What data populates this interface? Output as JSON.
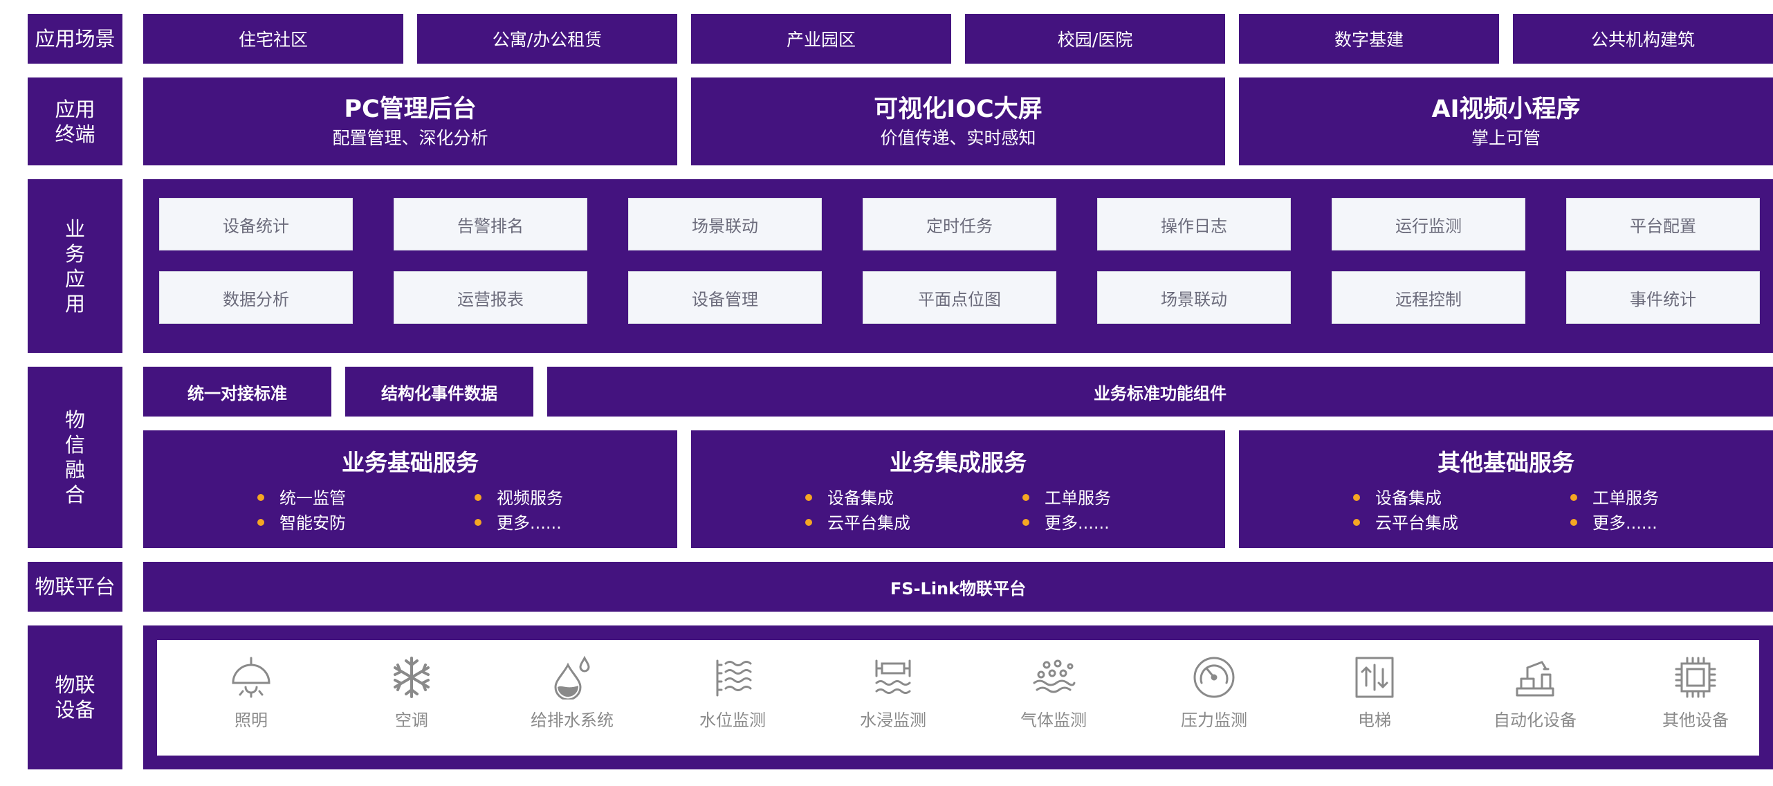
{
  "rows": {
    "scenarios": {
      "label": "应用场景",
      "items": [
        "住宅社区",
        "公寓/办公租赁",
        "产业园区",
        "校园/医院",
        "数字基建",
        "公共机构建筑"
      ]
    },
    "terminals": {
      "label_lines": [
        "应用",
        "终端"
      ],
      "items": [
        {
          "title": "PC管理后台",
          "subtitle": "配置管理、深化分析"
        },
        {
          "title": "可视化IOC大屏",
          "subtitle": "价值传递、实时感知"
        },
        {
          "title": "AI视频小程序",
          "subtitle": "掌上可管"
        }
      ]
    },
    "business": {
      "label_lines": [
        "业",
        "务",
        "应",
        "用"
      ],
      "row1": [
        "设备统计",
        "告警排名",
        "场景联动",
        "定时任务",
        "操作日志",
        "运行监测",
        "平台配置"
      ],
      "row2": [
        "数据分析",
        "运营报表",
        "设备管理",
        "平面点位图",
        "场景联动",
        "远程控制",
        "事件统计"
      ]
    },
    "fusion": {
      "label_lines": [
        "物",
        "信",
        "融",
        "合"
      ],
      "top": [
        "统一对接标准",
        "结构化事件数据",
        "业务标准功能组件"
      ],
      "services": [
        {
          "title": "业务基础服务",
          "items": [
            "统一监管",
            "视频服务",
            "智能安防",
            "更多......"
          ]
        },
        {
          "title": "业务集成服务",
          "items": [
            "设备集成",
            "工单服务",
            "云平台集成",
            "更多......"
          ]
        },
        {
          "title": "其他基础服务",
          "items": [
            "设备集成",
            "工单服务",
            "云平台集成",
            "更多......"
          ]
        }
      ]
    },
    "platform": {
      "label": "物联平台",
      "text": "FS-Link物联平台"
    },
    "devices": {
      "label_lines": [
        "物联",
        "设备"
      ],
      "items": [
        {
          "name": "照明",
          "icon": "lamp-icon"
        },
        {
          "name": "空调",
          "icon": "snowflake-icon"
        },
        {
          "name": "给排水系统",
          "icon": "water-drop-icon"
        },
        {
          "name": "水位监测",
          "icon": "water-level-icon"
        },
        {
          "name": "水浸监测",
          "icon": "flood-sensor-icon"
        },
        {
          "name": "气体监测",
          "icon": "gas-icon"
        },
        {
          "name": "压力监测",
          "icon": "pressure-gauge-icon"
        },
        {
          "name": "电梯",
          "icon": "elevator-icon"
        },
        {
          "name": "自动化设备",
          "icon": "robot-arm-icon"
        },
        {
          "name": "其他设备",
          "icon": "chip-icon"
        }
      ]
    }
  },
  "colors": {
    "primary": "#44137f",
    "accent": "#f5a623",
    "cell_bg": "#f4f6fa",
    "icon_gray": "#8a8a8a"
  }
}
